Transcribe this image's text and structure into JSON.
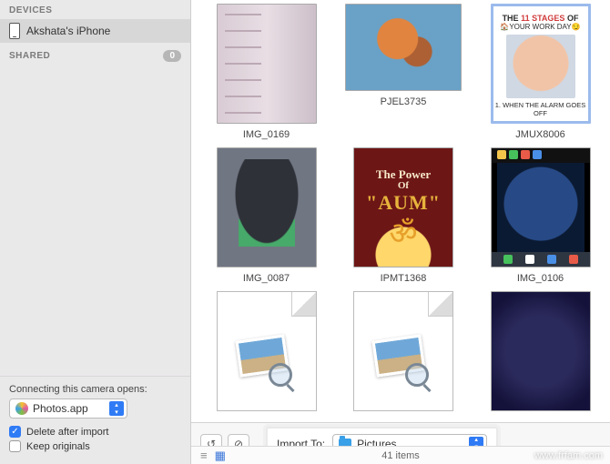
{
  "sidebar": {
    "devices_label": "DEVICES",
    "device_name": "Akshata's iPhone",
    "shared_label": "SHARED",
    "shared_count": "0",
    "open_with_label": "Connecting this camera opens:",
    "open_with_app": "Photos.app",
    "delete_after_label": "Delete after import",
    "keep_originals_label": "Keep originals"
  },
  "grid": {
    "items": [
      {
        "name": "IMG_0169"
      },
      {
        "name": "PJEL3735"
      },
      {
        "name": "JMUX8006",
        "top_a": "THE ",
        "top_b": "11 STAGES",
        "top_c": " OF",
        "sub": "🏠YOUR WORK DAY😏",
        "bottom": "1. WHEN THE ALARM GOES OFF"
      },
      {
        "name": "IMG_0087"
      },
      {
        "name": "IPMT1368",
        "p1": "The Power",
        "p2": "Of",
        "p3": "\"AUM\"",
        "om": "ॐ"
      },
      {
        "name": "IMG_0106"
      },
      {
        "name": ""
      },
      {
        "name": ""
      },
      {
        "name": ""
      }
    ]
  },
  "toolbar": {
    "import_to_label": "Import To:",
    "destination": "Pictures"
  },
  "footer": {
    "count": "41 items"
  },
  "watermark": "www.frfam.com"
}
